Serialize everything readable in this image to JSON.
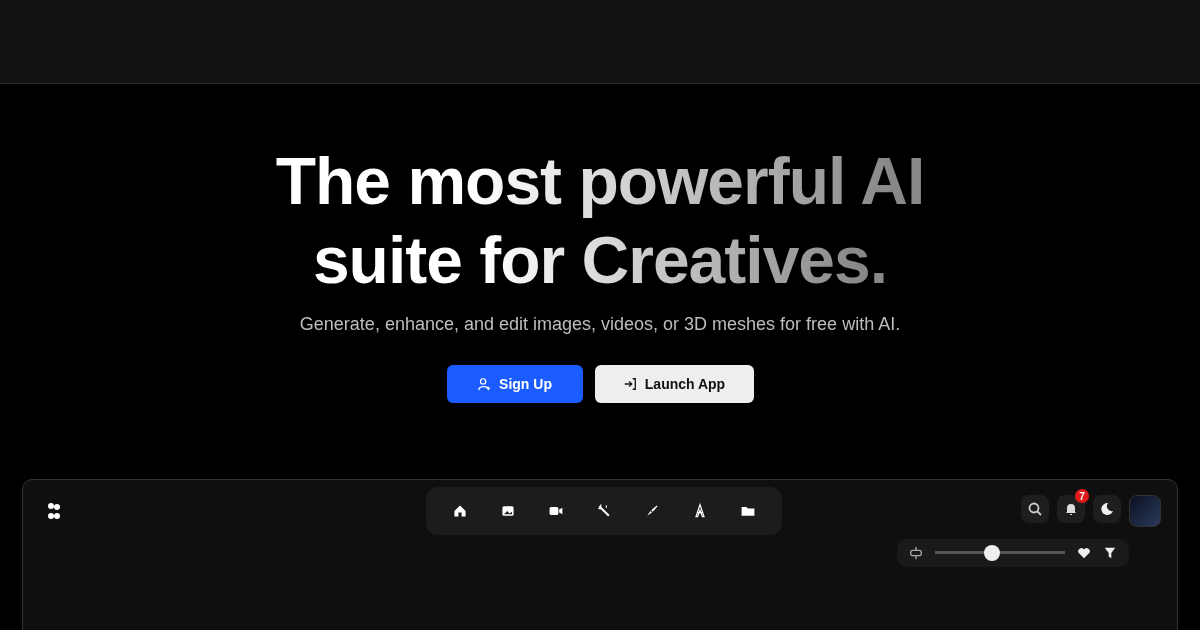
{
  "hero": {
    "title_lines": [
      "The most powerful AI",
      "suite for Creatives."
    ],
    "subtitle": "Generate, enhance, and edit images, videos, or 3D meshes for free with AI.",
    "buttons": [
      {
        "label": "Sign Up",
        "kind": "primary"
      },
      {
        "label": "Launch App",
        "kind": "secondary"
      }
    ]
  },
  "app_preview": {
    "notification_count": "7",
    "size_slider": {
      "level": 0.44
    }
  }
}
